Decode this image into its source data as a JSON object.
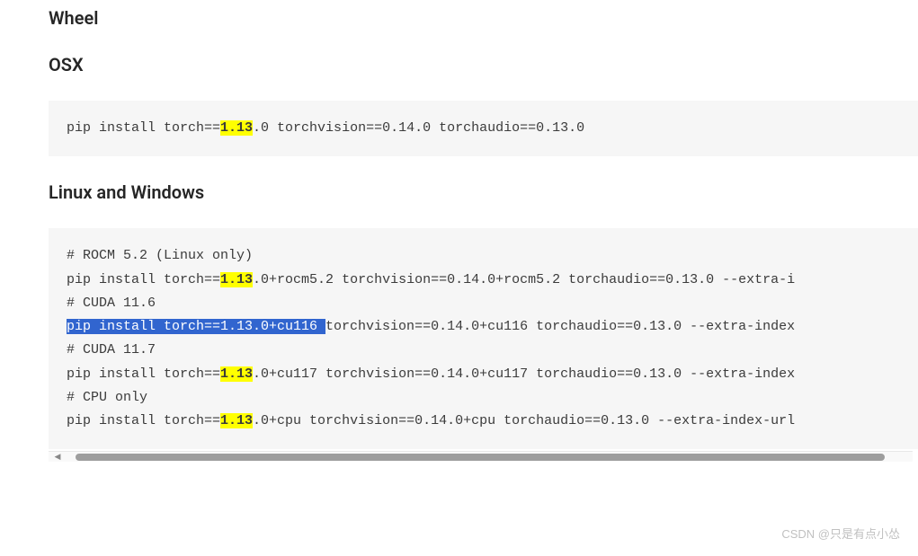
{
  "headings": {
    "wheel": "Wheel",
    "osx": "OSX",
    "linux_windows": "Linux and Windows"
  },
  "osx_block": {
    "line1_pre": "pip install torch==",
    "line1_hl": "1.13",
    "line1_post": ".0 torchvision==0.14.0 torchaudio==0.13.0"
  },
  "linux_block": {
    "comment_rocm": "# ROCM 5.2 (Linux only)",
    "rocm_pre": "pip install torch==",
    "rocm_hl": "1.13",
    "rocm_post": ".0+rocm5.2 torchvision==0.14.0+rocm5.2 torchaudio==0.13.0 --extra-i",
    "comment_cuda116": "# CUDA 11.6",
    "cuda116_sel": "pip install torch==1.13.0+cu116 ",
    "cuda116_post": "torchvision==0.14.0+cu116 torchaudio==0.13.0 --extra-index",
    "comment_cuda117": "# CUDA 11.7",
    "cuda117_pre": "pip install torch==",
    "cuda117_hl": "1.13",
    "cuda117_post": ".0+cu117 torchvision==0.14.0+cu117 torchaudio==0.13.0 --extra-index",
    "comment_cpu": "# CPU only",
    "cpu_pre": "pip install torch==",
    "cpu_hl": "1.13",
    "cpu_post": ".0+cpu torchvision==0.14.0+cpu torchaudio==0.13.0 --extra-index-url"
  },
  "watermark": "CSDN @只是有点小怂"
}
